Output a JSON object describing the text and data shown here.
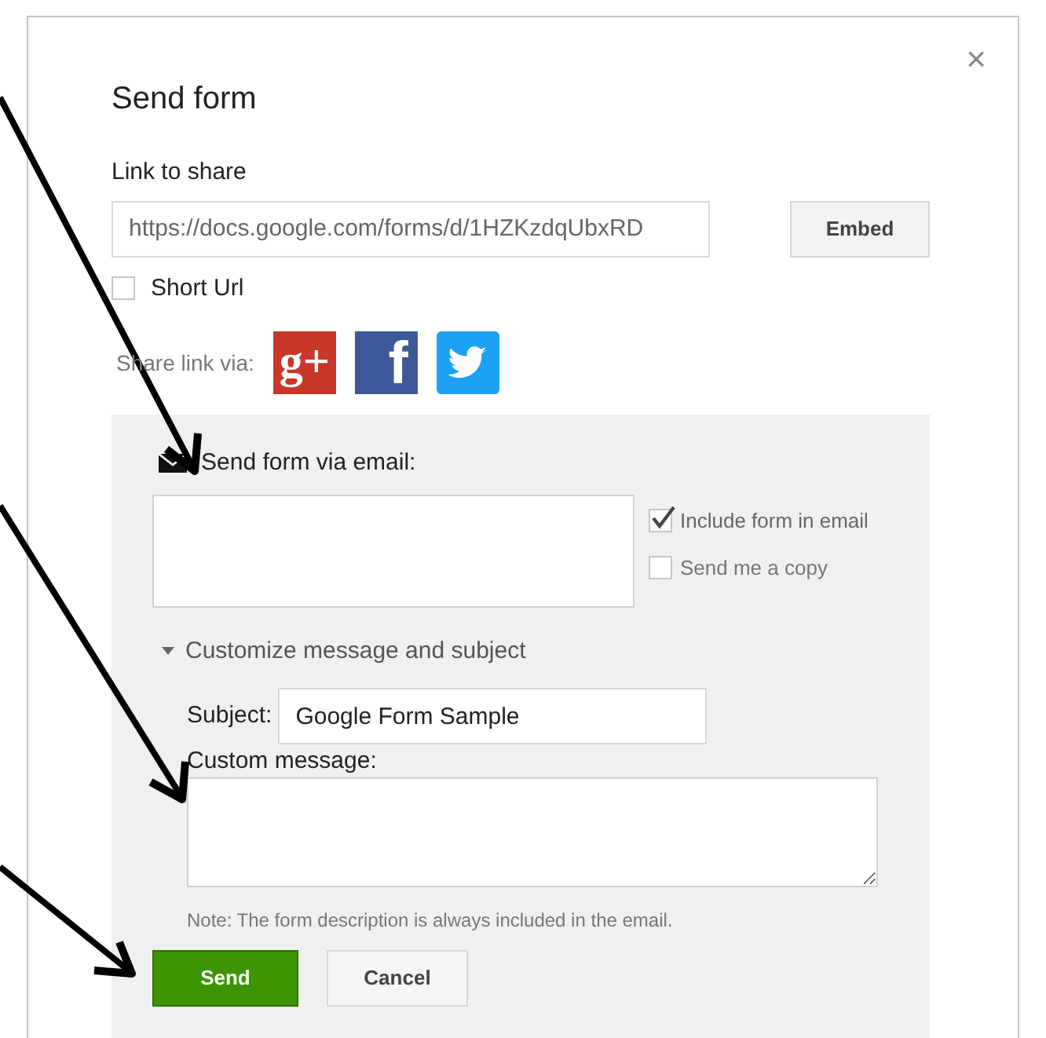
{
  "dialog": {
    "title": "Send form",
    "close": "×",
    "link_label": "Link to share",
    "link_value": "https://docs.google.com/forms/d/1HZKzdqUbxRD",
    "embed_button": "Embed",
    "short_url": {
      "label": "Short Url",
      "checked": false
    },
    "share_label": "Share link via:",
    "share_services": [
      {
        "kind": "gplus",
        "glyph": "g+"
      },
      {
        "kind": "facebook",
        "glyph": "f"
      },
      {
        "kind": "twitter"
      }
    ],
    "email_section": {
      "heading": "Send form via email:",
      "options": [
        {
          "label": "Include form in email",
          "checked": true
        },
        {
          "label": "Send me a copy",
          "checked": false
        }
      ],
      "customize": {
        "label": "Customize message and subject",
        "expanded": true
      },
      "subject_label": "Subject:",
      "subject_value": "Google Form Sample",
      "message_label": "Custom message:",
      "note": "Note: The form description is always included in the email."
    },
    "buttons": [
      {
        "label": "Send",
        "kind": "primary"
      },
      {
        "label": "Cancel",
        "kind": "secondary"
      }
    ]
  }
}
